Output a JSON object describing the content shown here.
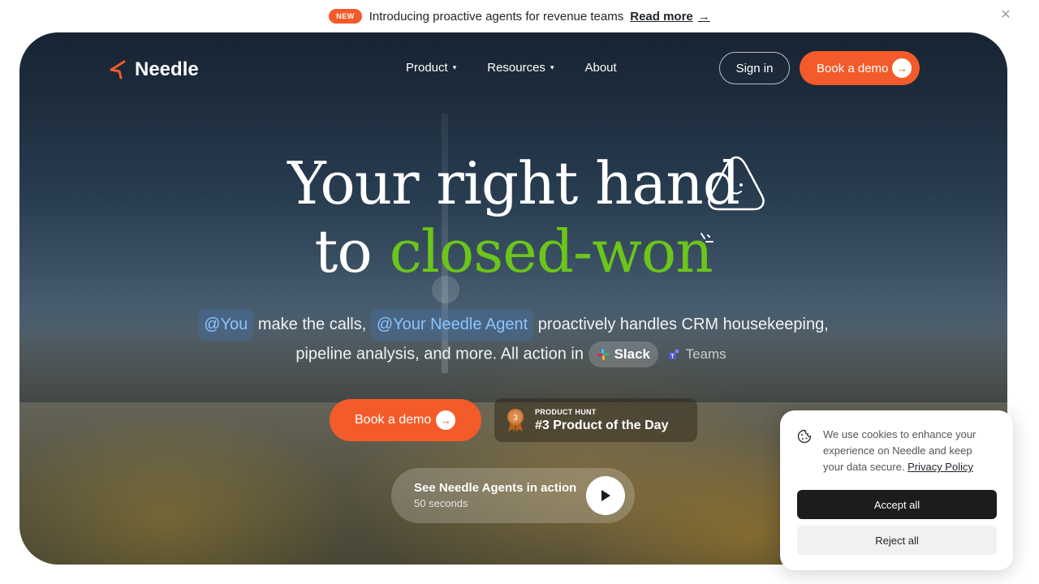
{
  "announcement": {
    "badge": "NEW",
    "text": "Introducing proactive agents for revenue teams",
    "link": "Read more"
  },
  "nav": {
    "brand": "Needle",
    "items": [
      {
        "label": "Product",
        "dropdown": true
      },
      {
        "label": "Resources",
        "dropdown": true
      },
      {
        "label": "About",
        "dropdown": false
      }
    ],
    "signin": "Sign in",
    "demo": "Book a demo"
  },
  "hero": {
    "line1": "Your right hand",
    "line2_prefix": "to",
    "line2_highlight": "closed-won",
    "chip_you": "@You",
    "text_a": "make the calls,",
    "chip_agent": "@Your Needle Agent",
    "text_b": "proactively handles CRM housekeeping,",
    "text_c": "pipeline analysis, and more. All action in",
    "slack": "Slack",
    "teams": "Teams",
    "cta": "Book a demo",
    "ph_label": "PRODUCT HUNT",
    "ph_title": "#3 Product of the Day",
    "ph_rank": "3",
    "video_title": "See Needle Agents in action",
    "video_sub": "50 seconds"
  },
  "cookie": {
    "text": "We use cookies to enhance your experience on Needle and keep your data secure.",
    "link": "Privacy Policy",
    "accept": "Accept all",
    "reject": "Reject all"
  },
  "colors": {
    "accent": "#f45b2a",
    "highlight_green": "#6cc51a",
    "chip_text": "#8cc4ff"
  }
}
